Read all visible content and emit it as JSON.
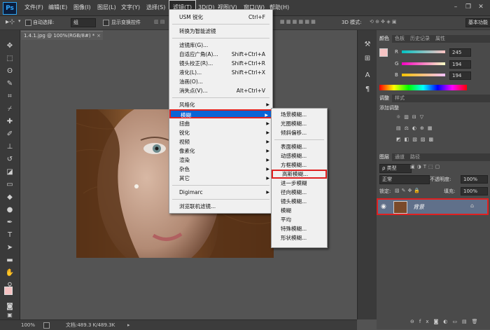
{
  "app": {
    "logo": "Ps"
  },
  "menubar": {
    "items": [
      "文件(F)",
      "编辑(E)",
      "图像(I)",
      "图层(L)",
      "文字(Y)",
      "选择(S)",
      "滤镜(T)",
      "3D(D)",
      "视图(V)",
      "窗口(W)",
      "帮助(H)"
    ],
    "active_index": 6
  },
  "options": {
    "auto_select_label": "自动选择:",
    "auto_select_value": "组",
    "show_transform_label": "显示变换控件",
    "mode_3d_label": "3D 模式:",
    "workspace": "基本功能"
  },
  "document": {
    "tab_title": "1.4.1.jpg @ 100%(RGB/8#) *"
  },
  "status": {
    "zoom": "100%",
    "doc_info": "文档:489.3 K/489.3K"
  },
  "filter_menu": {
    "items": [
      {
        "label": "USM 锐化",
        "shortcut": "Ctrl+F"
      },
      {
        "label": "转换为智能滤镜",
        "shortcut": ""
      },
      {
        "label": "滤镜库(G)...",
        "shortcut": ""
      },
      {
        "label": "自适应广角(A)...",
        "shortcut": "Shift+Ctrl+A"
      },
      {
        "label": "镜头校正(R)...",
        "shortcut": "Shift+Ctrl+R"
      },
      {
        "label": "液化(L)...",
        "shortcut": "Shift+Ctrl+X"
      },
      {
        "label": "油画(O)...",
        "shortcut": ""
      },
      {
        "label": "消失点(V)...",
        "shortcut": "Alt+Ctrl+V"
      },
      {
        "label": "风格化",
        "shortcut": ""
      },
      {
        "label": "模糊",
        "shortcut": ""
      },
      {
        "label": "扭曲",
        "shortcut": ""
      },
      {
        "label": "锐化",
        "shortcut": ""
      },
      {
        "label": "视频",
        "shortcut": ""
      },
      {
        "label": "像素化",
        "shortcut": ""
      },
      {
        "label": "渲染",
        "shortcut": ""
      },
      {
        "label": "杂色",
        "shortcut": ""
      },
      {
        "label": "其它",
        "shortcut": ""
      },
      {
        "label": "Digimarc",
        "shortcut": ""
      },
      {
        "label": "浏览联机滤镜...",
        "shortcut": ""
      }
    ]
  },
  "blur_submenu": {
    "items": [
      "场景模糊...",
      "光圈模糊...",
      "倾斜偏移...",
      "表面模糊...",
      "动感模糊...",
      "方框模糊...",
      "高斯模糊...",
      "进一步模糊",
      "径向模糊...",
      "镜头模糊...",
      "模糊",
      "平均",
      "特殊模糊...",
      "形状模糊..."
    ]
  },
  "color_panel": {
    "tabs": [
      "颜色",
      "色板",
      "历史记录",
      "属性"
    ],
    "channels": [
      {
        "name": "R",
        "value": "245"
      },
      {
        "name": "G",
        "value": "194"
      },
      {
        "name": "B",
        "value": "194"
      }
    ],
    "fg_color": "#f5c2c2"
  },
  "adjust_panel": {
    "tabs": [
      "调整",
      "样式"
    ],
    "title": "添加调整"
  },
  "layers_panel": {
    "tabs": [
      "图层",
      "通道",
      "路径"
    ],
    "kind_label": "ρ 类型",
    "blend_mode": "正常",
    "opacity_label": "不透明度:",
    "opacity_value": "100%",
    "lock_label": "锁定:",
    "fill_label": "填充:",
    "fill_value": "100%",
    "layer_name": "背景"
  }
}
